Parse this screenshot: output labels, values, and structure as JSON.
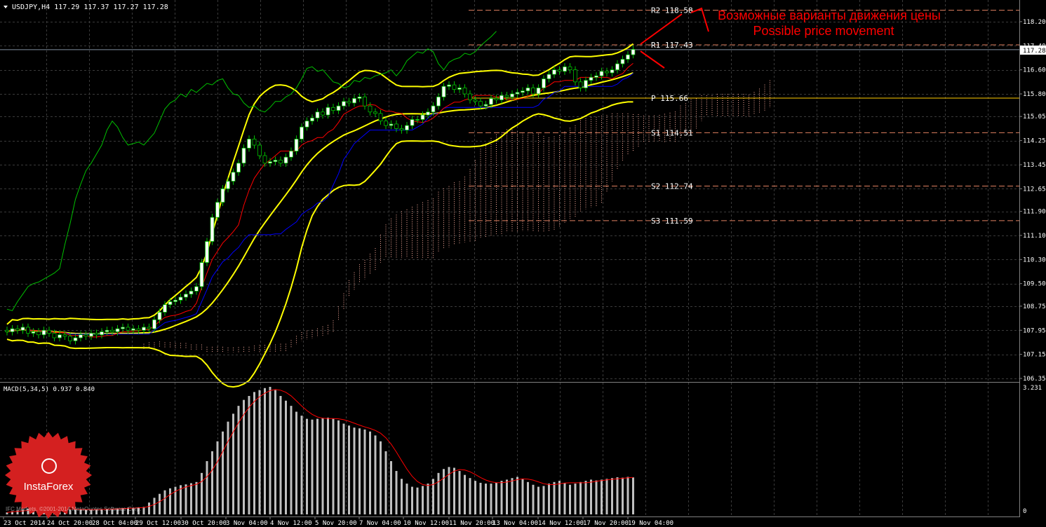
{
  "main_header": "USDJPY,H4  117.29 117.37 117.27 117.28",
  "macd_header": "MACD(5,34,5) 0.937 0.840",
  "annotation_ru": "Возможные варианты движения цены",
  "annotation_en": "Possible price movement",
  "logo_text": "InstaForex",
  "copyright": "IFC Markets, ©2001-2014 MetaQuotes Software Corp.",
  "current_price": "117.28",
  "macd_axis": {
    "top": "3.231",
    "bottom": "0"
  },
  "colors": {
    "background": "#000000",
    "grid": "#3a3a3a",
    "bull": "#ffffff",
    "bear": "#000000",
    "candle_outline": "#00c000",
    "bollinger": "#ffff00",
    "tenkan": "#ff0000",
    "kijun": "#0000ff",
    "chikou": "#00c000",
    "cloud": "#ffb0a0",
    "pivot_dashed": "#e08060",
    "pivot_line": "#ffcc00",
    "macd_hist": "#c0c0c0",
    "macd_signal": "#ff0000",
    "annotation": "#ff0000",
    "axis_text": "#ffffff"
  },
  "pivot_levels": [
    {
      "label": "R2 118.58",
      "value": 118.58,
      "style": "dashed"
    },
    {
      "label": "R1 117.43",
      "value": 117.43,
      "style": "dashed"
    },
    {
      "label": "P 115.66",
      "value": 115.66,
      "style": "solid"
    },
    {
      "label": "S1 114.51",
      "value": 114.51,
      "style": "dashed"
    },
    {
      "label": "S2 112.74",
      "value": 112.74,
      "style": "dashed"
    },
    {
      "label": "S3 111.59",
      "value": 111.59,
      "style": "dashed"
    }
  ],
  "chart_data": [
    {
      "type": "candlestick",
      "title": "USDJPY,H4  117.29 117.37 117.27 117.28",
      "symbol": "USDJPY",
      "timeframe": "H4",
      "ylim": [
        106.35,
        118.5
      ],
      "y_ticks": [
        "118.20",
        "117.40",
        "116.60",
        "115.80",
        "115.05",
        "114.25",
        "113.45",
        "112.65",
        "111.90",
        "111.10",
        "110.30",
        "109.50",
        "108.75",
        "107.95",
        "107.15",
        "106.35"
      ],
      "x_tick_labels": [
        "23 Oct 2014",
        "24 Oct 20:00",
        "28 Oct 04:00",
        "29 Oct 12:00",
        "30 Oct 20:00",
        "3 Nov 04:00",
        "4 Nov 12:00",
        "5 Nov 20:00",
        "7 Nov 04:00",
        "10 Nov 12:00",
        "11 Nov 20:00",
        "13 Nov 04:00",
        "14 Nov 12:00",
        "17 Nov 20:00",
        "19 Nov 04:00"
      ],
      "bar_count": 120,
      "close": [
        107.9,
        108.0,
        107.95,
        108.05,
        107.85,
        107.9,
        107.8,
        107.95,
        107.85,
        107.7,
        107.8,
        107.75,
        107.6,
        107.7,
        107.8,
        107.75,
        107.85,
        107.8,
        107.9,
        107.95,
        107.9,
        108.0,
        108.05,
        107.95,
        108.0,
        107.95,
        108.05,
        108.0,
        108.3,
        108.55,
        108.8,
        108.9,
        108.95,
        109.05,
        109.15,
        109.25,
        109.4,
        110.2,
        110.9,
        111.7,
        112.2,
        112.65,
        112.9,
        113.2,
        113.5,
        114.0,
        114.3,
        114.1,
        113.75,
        113.5,
        113.55,
        113.6,
        113.5,
        113.7,
        113.9,
        114.3,
        114.7,
        114.9,
        115.0,
        115.2,
        115.1,
        115.35,
        115.25,
        115.4,
        115.55,
        115.5,
        115.65,
        115.7,
        115.4,
        115.2,
        115.15,
        114.9,
        114.75,
        114.8,
        114.65,
        114.6,
        114.75,
        114.95,
        114.95,
        115.1,
        115.2,
        115.4,
        115.7,
        116.05,
        116.1,
        115.95,
        116.0,
        115.8,
        115.6,
        115.55,
        115.4,
        115.45,
        115.65,
        115.6,
        115.75,
        115.7,
        115.8,
        115.85,
        115.9,
        116.0,
        115.8,
        116.0,
        116.3,
        116.45,
        116.6,
        116.55,
        116.7,
        116.6,
        116.2,
        116.0,
        116.25,
        116.35,
        116.4,
        116.55,
        116.5,
        116.6,
        116.8,
        116.95,
        117.1,
        117.28
      ],
      "open_delta": [
        0.05,
        -0.1,
        0.05,
        -0.1,
        0.2,
        -0.05,
        0.1,
        -0.15,
        0.1,
        0.15,
        -0.1,
        0.05,
        0.15,
        -0.1,
        -0.1,
        0.05,
        -0.1,
        0.05,
        -0.1,
        -0.05,
        0.05,
        -0.1,
        -0.05,
        0.1,
        -0.05,
        0.05,
        -0.1,
        0.05,
        -0.3,
        -0.25,
        -0.25,
        -0.1,
        -0.05,
        -0.1,
        -0.1,
        -0.1,
        -0.15,
        -0.8,
        -0.7,
        -0.8,
        -0.5,
        -0.45,
        -0.25,
        -0.3,
        -0.3,
        -0.5,
        -0.3,
        0.2,
        0.35,
        0.25,
        -0.05,
        -0.05,
        0.1,
        -0.2,
        -0.2,
        -0.4,
        -0.4,
        -0.2,
        -0.1,
        -0.2,
        0.1,
        -0.25,
        0.1,
        -0.15,
        -0.15,
        0.05,
        -0.15,
        -0.05,
        0.3,
        0.2,
        0.05,
        0.25,
        0.15,
        -0.05,
        0.15,
        0.05,
        -0.15,
        -0.2,
        0.0,
        -0.15,
        -0.1,
        -0.2,
        -0.3,
        -0.35,
        -0.05,
        0.15,
        -0.05,
        0.2,
        0.2,
        0.05,
        0.15,
        -0.05,
        -0.2,
        0.05,
        -0.15,
        0.05,
        -0.1,
        -0.05,
        -0.05,
        -0.1,
        0.2,
        -0.2,
        -0.3,
        -0.15,
        -0.15,
        0.05,
        -0.15,
        0.1,
        0.4,
        0.2,
        -0.25,
        -0.1,
        -0.05,
        -0.15,
        0.05,
        -0.1,
        -0.2,
        -0.15,
        -0.15,
        -0.18
      ],
      "indicators": [
        "Bollinger Bands (upper, middle, lower)",
        "Ichimoku (Tenkan, Kijun, Chikou, Cloud)",
        "Pivot levels"
      ]
    },
    {
      "type": "bar",
      "title": "MACD(5,34,5) 0.937 0.840",
      "ylim": [
        0,
        3.231
      ],
      "histogram": [
        0.05,
        0.08,
        0.1,
        0.12,
        0.14,
        0.15,
        0.15,
        0.16,
        0.16,
        0.15,
        0.14,
        0.13,
        0.12,
        0.12,
        0.12,
        0.12,
        0.12,
        0.13,
        0.13,
        0.14,
        0.14,
        0.15,
        0.16,
        0.17,
        0.17,
        0.18,
        0.19,
        0.3,
        0.42,
        0.52,
        0.61,
        0.66,
        0.7,
        0.74,
        0.76,
        0.79,
        0.82,
        1.05,
        1.35,
        1.6,
        1.85,
        2.1,
        2.35,
        2.55,
        2.75,
        2.9,
        3.0,
        3.1,
        3.15,
        3.2,
        3.23,
        3.15,
        3.0,
        2.88,
        2.75,
        2.6,
        2.5,
        2.42,
        2.4,
        2.42,
        2.44,
        2.45,
        2.42,
        2.38,
        2.3,
        2.25,
        2.2,
        2.18,
        2.15,
        2.1,
        2.0,
        1.85,
        1.6,
        1.35,
        1.1,
        0.9,
        0.78,
        0.7,
        0.68,
        0.72,
        0.78,
        0.9,
        1.05,
        1.15,
        1.2,
        1.18,
        1.1,
        1.0,
        0.92,
        0.85,
        0.8,
        0.78,
        0.78,
        0.8,
        0.85,
        0.88,
        0.92,
        0.95,
        0.9,
        0.82,
        0.75,
        0.7,
        0.72,
        0.78,
        0.82,
        0.85,
        0.8,
        0.75,
        0.78,
        0.82,
        0.85,
        0.88,
        0.86,
        0.88,
        0.9,
        0.92,
        0.94,
        0.93,
        0.95,
        0.937
      ],
      "signal_last": 0.84
    }
  ]
}
